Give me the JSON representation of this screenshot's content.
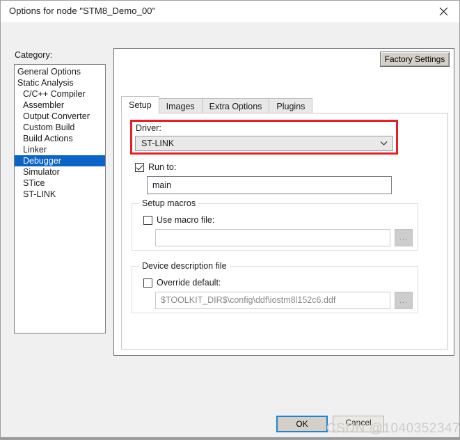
{
  "window": {
    "title": "Options for node \"STM8_Demo_00\"",
    "close_icon": "close-icon"
  },
  "category": {
    "label": "Category:",
    "items": [
      {
        "label": "General Options",
        "indent": false,
        "selected": false
      },
      {
        "label": "Static Analysis",
        "indent": false,
        "selected": false
      },
      {
        "label": "C/C++ Compiler",
        "indent": true,
        "selected": false
      },
      {
        "label": "Assembler",
        "indent": true,
        "selected": false
      },
      {
        "label": "Output Converter",
        "indent": true,
        "selected": false
      },
      {
        "label": "Custom Build",
        "indent": true,
        "selected": false
      },
      {
        "label": "Build Actions",
        "indent": true,
        "selected": false
      },
      {
        "label": "Linker",
        "indent": true,
        "selected": false
      },
      {
        "label": "Debugger",
        "indent": true,
        "selected": true
      },
      {
        "label": "Simulator",
        "indent": true,
        "selected": false
      },
      {
        "label": "STice",
        "indent": true,
        "selected": false
      },
      {
        "label": "ST-LINK",
        "indent": true,
        "selected": false
      }
    ]
  },
  "panel": {
    "factory_settings_label": "Factory Settings",
    "tabs": [
      {
        "label": "Setup",
        "active": true
      },
      {
        "label": "Images",
        "active": false
      },
      {
        "label": "Extra Options",
        "active": false
      },
      {
        "label": "Plugins",
        "active": false
      }
    ]
  },
  "setup": {
    "driver": {
      "label": "Driver:",
      "value": "ST-LINK",
      "arrow_icon": "chevron-down-icon",
      "highlight_color": "#ed1c24"
    },
    "run_to": {
      "label": "Run to:",
      "checked": true,
      "value": "main"
    },
    "setup_macros": {
      "title": "Setup macros",
      "use_macro_file": {
        "label": "Use macro file:",
        "checked": false
      },
      "path_value": "",
      "browse_label": "..."
    },
    "device_description": {
      "title": "Device description file",
      "override_default": {
        "label": "Override default:",
        "checked": false
      },
      "path_value": "$TOOLKIT_DIR$\\config\\ddf\\iostm8l152c6.ddf",
      "browse_label": "..."
    }
  },
  "footer": {
    "ok_label": "OK",
    "cancel_label": "Cancel"
  },
  "watermark": {
    "text": "CSDN @1040352347"
  }
}
